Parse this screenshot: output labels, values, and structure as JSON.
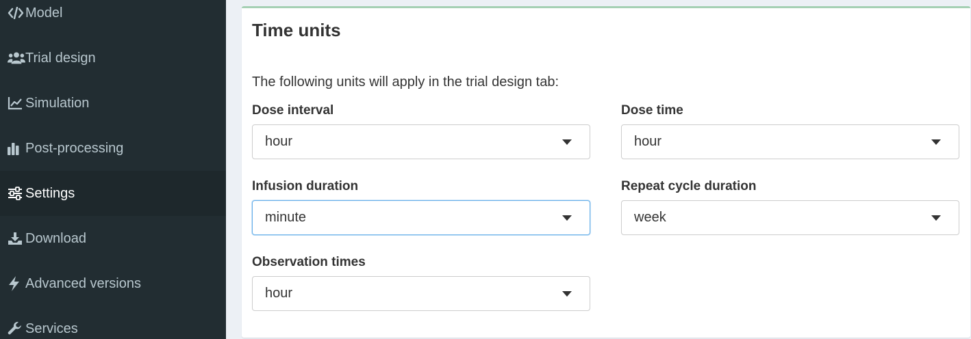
{
  "sidebar": {
    "items": [
      {
        "label": "Model",
        "icon": "code-icon",
        "active": false
      },
      {
        "label": "Trial design",
        "icon": "users-icon",
        "active": false
      },
      {
        "label": "Simulation",
        "icon": "line-chart-icon",
        "active": false
      },
      {
        "label": "Post-processing",
        "icon": "bar-chart-icon",
        "active": false
      },
      {
        "label": "Settings",
        "icon": "sliders-icon",
        "active": true
      },
      {
        "label": "Download",
        "icon": "download-icon",
        "active": false
      },
      {
        "label": "Advanced versions",
        "icon": "bolt-icon",
        "active": false
      },
      {
        "label": "Services",
        "icon": "wrench-icon",
        "active": false
      }
    ]
  },
  "main": {
    "title": "Time units",
    "description": "The following units will apply in the trial design tab:",
    "fields": {
      "dose_interval": {
        "label": "Dose interval",
        "value": "hour"
      },
      "dose_time": {
        "label": "Dose time",
        "value": "hour"
      },
      "infusion_duration": {
        "label": "Infusion duration",
        "value": "minute"
      },
      "repeat_cycle_duration": {
        "label": "Repeat cycle duration",
        "value": "week"
      },
      "observation_times": {
        "label": "Observation times",
        "value": "hour"
      }
    }
  },
  "colors": {
    "sidebar_bg": "#222d32",
    "sidebar_active_bg": "#1e282c",
    "sidebar_text": "#b8c7ce",
    "box_top_border": "#a5d0b4",
    "focus_border": "#66afe9"
  }
}
